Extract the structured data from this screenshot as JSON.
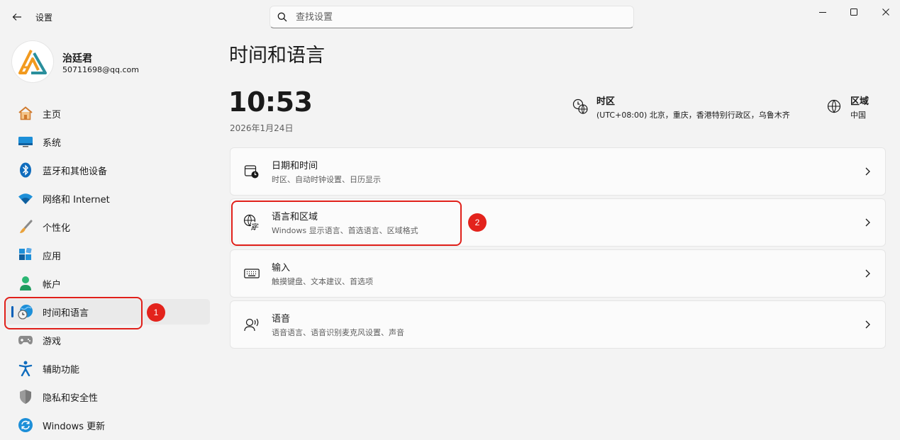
{
  "titlebar": {
    "title": "设置",
    "search_placeholder": "查找设置"
  },
  "profile": {
    "name": "治廷君",
    "email": "50711698@qq.com"
  },
  "nav": {
    "items": [
      {
        "label": "主页",
        "icon": "home-icon"
      },
      {
        "label": "系统",
        "icon": "monitor-icon"
      },
      {
        "label": "蓝牙和其他设备",
        "icon": "bluetooth-icon"
      },
      {
        "label": "网络和 Internet",
        "icon": "wifi-icon"
      },
      {
        "label": "个性化",
        "icon": "brush-icon"
      },
      {
        "label": "应用",
        "icon": "apps-icon"
      },
      {
        "label": "帐户",
        "icon": "person-icon"
      },
      {
        "label": "时间和语言",
        "icon": "globe-clock-icon",
        "active": true
      },
      {
        "label": "游戏",
        "icon": "gamepad-icon"
      },
      {
        "label": "辅助功能",
        "icon": "accessibility-icon"
      },
      {
        "label": "隐私和安全性",
        "icon": "shield-icon"
      },
      {
        "label": "Windows 更新",
        "icon": "update-icon"
      }
    ]
  },
  "main": {
    "title": "时间和语言",
    "time": "10:53",
    "date": "2026年1月24日",
    "timezone": {
      "title": "时区",
      "value": "(UTC+08:00) 北京，重庆，香港特别行政区，乌鲁木齐"
    },
    "region": {
      "title": "区域",
      "value": "中国"
    },
    "cards": [
      {
        "title": "日期和时间",
        "subtitle": "时区、自动时钟设置、日历显示",
        "icon": "calendar-clock-icon"
      },
      {
        "title": "语言和区域",
        "subtitle": "Windows 显示语言、首选语言、区域格式",
        "icon": "language-icon"
      },
      {
        "title": "输入",
        "subtitle": "触摸键盘、文本建议、首选项",
        "icon": "keyboard-icon"
      },
      {
        "title": "语音",
        "subtitle": "语音语言、语音识别麦克风设置、声音",
        "icon": "speech-icon"
      }
    ]
  },
  "annotations": {
    "badge1": "1",
    "badge2": "2",
    "color": "#e3231c"
  },
  "colors": {
    "accent": "#005fb8",
    "background": "#f3f3f3",
    "card": "#fbfbfb"
  }
}
